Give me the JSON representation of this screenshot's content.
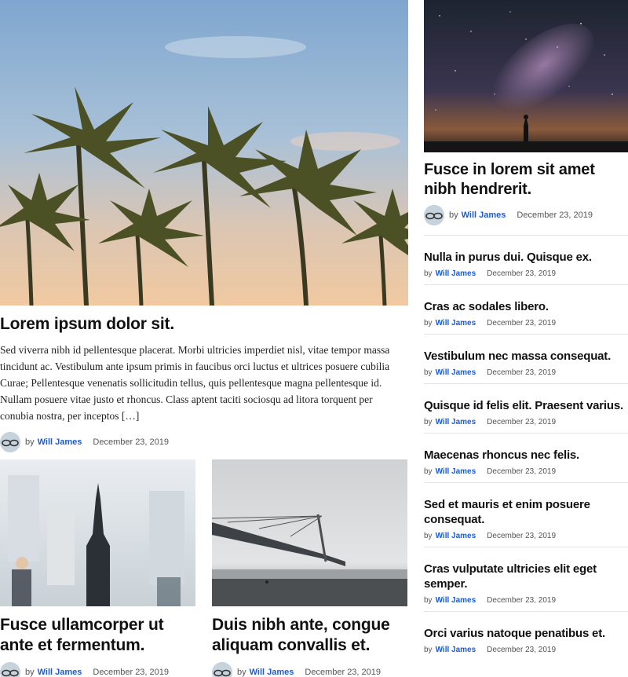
{
  "featured": {
    "title": "Lorem ipsum dolor sit.",
    "excerpt": "Sed viverra nibh id pellentesque placerat. Morbi ultricies imperdiet nisl, vitae tempor massa tincidunt ac. Vestibulum ante ipsum primis in faucibus orci luctus et ultrices posuere cubilia Curae; Pellentesque venenatis sollicitudin tellus, quis pellentesque magna pellentesque id. Nullam posuere vitae justo et rhoncus. Class aptent taciti sociosqu ad litora torquent per conubia nostra, per inceptos […]",
    "by": "by",
    "author": "Will James",
    "date": "December 23, 2019"
  },
  "cards": [
    {
      "title": "Fusce ullamcorper ut ante et fermentum.",
      "by": "by",
      "author": "Will James",
      "date": "December 23, 2019"
    },
    {
      "title": "Duis nibh ante, congue aliquam convallis et.",
      "by": "by",
      "author": "Will James",
      "date": "December 23, 2019"
    }
  ],
  "sidebar": {
    "top": {
      "title": "Fusce in lorem sit amet nibh hendrerit.",
      "by": "by",
      "author": "Will James",
      "date": "December 23, 2019"
    },
    "items": [
      {
        "title": "Nulla in purus dui. Quisque ex.",
        "by": "by",
        "author": "Will James",
        "date": "December 23, 2019"
      },
      {
        "title": "Cras ac sodales libero.",
        "by": "by",
        "author": "Will James",
        "date": "December 23, 2019"
      },
      {
        "title": "Vestibulum nec massa consequat.",
        "by": "by",
        "author": "Will James",
        "date": "December 23, 2019"
      },
      {
        "title": "Quisque id felis elit. Praesent varius.",
        "by": "by",
        "author": "Will James",
        "date": "December 23, 2019"
      },
      {
        "title": "Maecenas rhoncus nec felis.",
        "by": "by",
        "author": "Will James",
        "date": "December 23, 2019"
      },
      {
        "title": "Sed et mauris et enim posuere consequat.",
        "by": "by",
        "author": "Will James",
        "date": "December 23, 2019"
      },
      {
        "title": "Cras vulputate ultricies elit eget semper.",
        "by": "by",
        "author": "Will James",
        "date": "December 23, 2019"
      },
      {
        "title": "Orci varius natoque penatibus et.",
        "by": "by",
        "author": "Will James",
        "date": "December 23, 2019"
      }
    ]
  },
  "colors": {
    "author_link": "#1a5cd6",
    "divider": "#e3e3e3"
  }
}
